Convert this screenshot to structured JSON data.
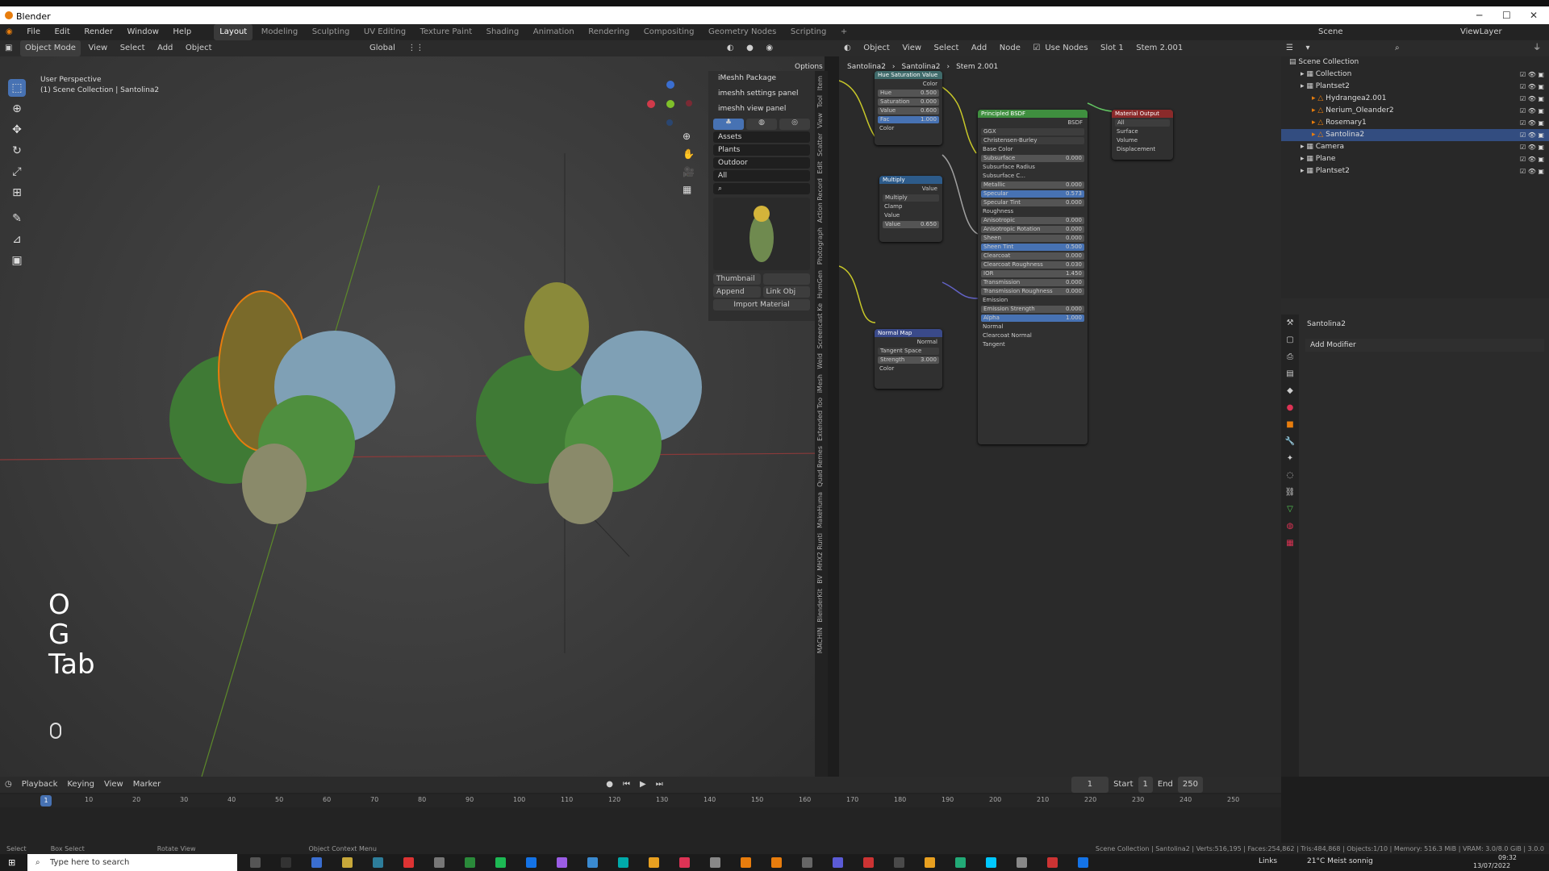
{
  "app": {
    "title": "Blender"
  },
  "menu": [
    "File",
    "Edit",
    "Render",
    "Window",
    "Help"
  ],
  "workspaces": [
    "Layout",
    "Modeling",
    "Sculpting",
    "UV Editing",
    "Texture Paint",
    "Shading",
    "Animation",
    "Rendering",
    "Compositing",
    "Geometry Nodes",
    "Scripting"
  ],
  "viewport_header": {
    "mode": "Object Mode",
    "items": [
      "View",
      "Select",
      "Add",
      "Object"
    ],
    "orientation": "Global",
    "options": "Options"
  },
  "viewport": {
    "perspective": "User Perspective",
    "collection": "(1) Scene Collection | Santolina2",
    "keys": [
      "O",
      "G",
      "Tab"
    ]
  },
  "npanel": {
    "sections": [
      "iMeshh Package",
      "imeshh settings panel",
      "imeshh view panel"
    ],
    "dropdowns": [
      "Assets",
      "Plants",
      "Outdoor",
      "All"
    ],
    "thumbnail": "Thumbnail",
    ".blend": ".blend",
    "append": "Append",
    "link": "Link Obj",
    "import": "Import Material"
  },
  "side_tabs": [
    "Item",
    "Tool",
    "View",
    "Scatter",
    "Edit",
    "Action Record",
    "Photograph",
    "HumGen",
    "Screencast Ke",
    "Weld",
    "iMesh",
    "Extended Too",
    "Quad Remes",
    "MakeHuma",
    "MHX2 Runti",
    "BV",
    "BlenderKit",
    "MACHIN"
  ],
  "node_header": {
    "object": "Object",
    "items": [
      "View",
      "Select",
      "Add",
      "Node"
    ],
    "use_nodes": "Use Nodes",
    "slot": "Slot 1",
    "material": "Stem 2.001"
  },
  "breadcrumb": [
    "Santolina2",
    "Santolina2",
    "Stem 2.001"
  ],
  "nodes": {
    "hsv": {
      "title": "Hue Saturation Value",
      "out": "Color",
      "fields": [
        [
          "Hue",
          "0.500"
        ],
        [
          "Saturation",
          "0.000"
        ],
        [
          "Value",
          "0.600"
        ],
        [
          "Fac",
          "1.000"
        ]
      ],
      "in": "Color"
    },
    "multiply": {
      "title": "Multiply",
      "out": "Value",
      "op": "Multiply",
      "clamp": "Clamp",
      "in": "Value",
      "value": [
        "Value",
        "0.650"
      ]
    },
    "normalmap": {
      "title": "Normal Map",
      "out": "Normal",
      "space": "Tangent Space",
      "strength": [
        "Strength",
        "3.000"
      ],
      "in": "Color"
    },
    "bsdf": {
      "title": "Principled BSDF",
      "out": "BSDF",
      "dist": "GGX",
      "sss": "Christensen-Burley",
      "base": "Base Color",
      "fields": [
        [
          "Subsurface",
          "0.000"
        ],
        [
          "Subsurface Radius",
          ""
        ],
        [
          "Subsurface C...",
          ""
        ],
        [
          "Metallic",
          "0.000"
        ],
        [
          "Specular",
          "0.573"
        ],
        [
          "Specular Tint",
          "0.000"
        ],
        [
          "Roughness",
          ""
        ],
        [
          "Anisotropic",
          "0.000"
        ],
        [
          "Anisotropic Rotation",
          "0.000"
        ],
        [
          "Sheen",
          "0.000"
        ],
        [
          "Sheen Tint",
          "0.500"
        ],
        [
          "Clearcoat",
          "0.000"
        ],
        [
          "Clearcoat Roughness",
          "0.030"
        ],
        [
          "IOR",
          "1.450"
        ],
        [
          "Transmission",
          "0.000"
        ],
        [
          "Transmission Roughness",
          "0.000"
        ],
        [
          "Emission",
          ""
        ],
        [
          "Emission Strength",
          "0.000"
        ],
        [
          "Alpha",
          "1.000"
        ],
        [
          "Normal",
          ""
        ],
        [
          "Clearcoat Normal",
          ""
        ],
        [
          "Tangent",
          ""
        ]
      ]
    },
    "output": {
      "title": "Material Output",
      "target": "All",
      "sockets": [
        "Surface",
        "Volume",
        "Displacement"
      ]
    }
  },
  "outliner_header": {
    "scene": "Scene",
    "viewlayer": "ViewLayer"
  },
  "outliner": [
    {
      "label": "Scene Collection",
      "indent": 0
    },
    {
      "label": "Collection",
      "indent": 1
    },
    {
      "label": "Plantset2",
      "indent": 1
    },
    {
      "label": "Hydrangea2.001",
      "indent": 2
    },
    {
      "label": "Nerium_Oleander2",
      "indent": 2
    },
    {
      "label": "Rosemary1",
      "indent": 2
    },
    {
      "label": "Santolina2",
      "indent": 2,
      "selected": true
    },
    {
      "label": "Camera",
      "indent": 1
    },
    {
      "label": "Plane",
      "indent": 1
    },
    {
      "label": "Plantset2",
      "indent": 1
    }
  ],
  "properties": {
    "object": "Santolina2",
    "add_modifier": "Add Modifier"
  },
  "timeline": {
    "items": [
      "Playback",
      "Keying",
      "View",
      "Marker"
    ],
    "current_frame": "1",
    "start_label": "Start",
    "start": "1",
    "end_label": "End",
    "end": "250",
    "ticks": [
      "10",
      "20",
      "30",
      "40",
      "50",
      "60",
      "70",
      "80",
      "90",
      "100",
      "110",
      "120",
      "130",
      "140",
      "150",
      "160",
      "170",
      "180",
      "190",
      "200",
      "210",
      "220",
      "230",
      "240",
      "250"
    ]
  },
  "status": {
    "left": [
      "Select",
      "Box Select",
      "Rotate View",
      "Object Context Menu"
    ],
    "right": "Scene Collection | Santolina2 | Verts:516,195 | Faces:254,862 | Tris:484,868 | Objects:1/10 | Memory: 516.3 MiB | VRAM: 3.0/8.0 GiB | 3.0.0"
  },
  "taskbar": {
    "search": "Type here to search",
    "links": "Links",
    "weather": "21°C  Meist sonnig",
    "time": "09:32",
    "date": "13/07/2022"
  },
  "colors": {
    "accent": "#4772b3",
    "selected_orange": "#e87d0d"
  }
}
